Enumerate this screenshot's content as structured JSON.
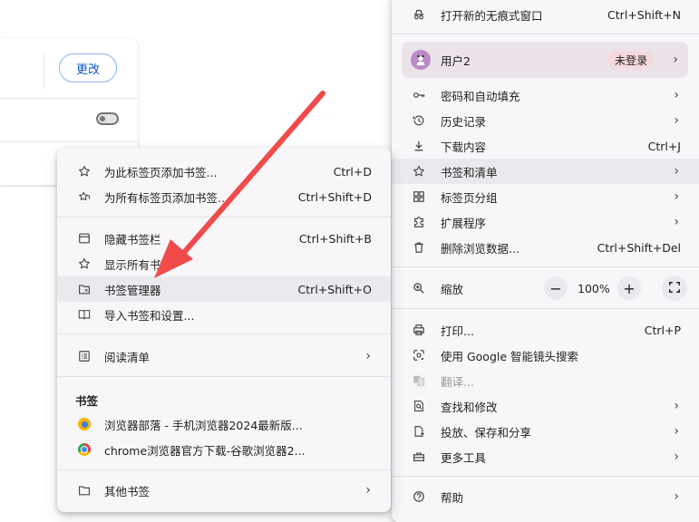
{
  "background": {
    "change_label": "更改"
  },
  "main_menu": {
    "incognito": {
      "label": "打开新的无痕式窗口",
      "shortcut": "Ctrl+Shift+N"
    },
    "profile": {
      "name": "用户2",
      "status": "未登录"
    },
    "passwords": {
      "label": "密码和自动填充"
    },
    "history": {
      "label": "历史记录"
    },
    "downloads": {
      "label": "下载内容",
      "shortcut": "Ctrl+J"
    },
    "bookmarks": {
      "label": "书签和清单"
    },
    "tab_groups": {
      "label": "标签页分组"
    },
    "extensions": {
      "label": "扩展程序"
    },
    "clear_data": {
      "label": "删除浏览数据...",
      "shortcut": "Ctrl+Shift+Del"
    },
    "zoom": {
      "label": "缩放",
      "minus": "−",
      "value": "100%",
      "plus": "+"
    },
    "print": {
      "label": "打印...",
      "shortcut": "Ctrl+P"
    },
    "lens": {
      "label": "使用 Google 智能镜头搜索"
    },
    "translate": {
      "label": "翻译..."
    },
    "find": {
      "label": "查找和修改"
    },
    "cast": {
      "label": "投放、保存和分享"
    },
    "more_tools": {
      "label": "更多工具"
    },
    "help": {
      "label": "帮助"
    }
  },
  "bookmark_menu": {
    "add_this": {
      "label": "为此标签页添加书签...",
      "shortcut": "Ctrl+D"
    },
    "add_all": {
      "label": "为所有标签页添加书签...",
      "shortcut": "Ctrl+Shift+D"
    },
    "hide_bar": {
      "label": "隐藏书签栏",
      "shortcut": "Ctrl+Shift+B"
    },
    "show_all": {
      "label": "显示所有书"
    },
    "manager": {
      "label": "书签管理器",
      "shortcut": "Ctrl+Shift+O"
    },
    "import": {
      "label": "导入书签和设置..."
    },
    "reading_list": {
      "label": "阅读清单"
    },
    "section_title": "书签",
    "bookmark_1": {
      "label": "浏览器部落 - 手机浏览器2024最新版..."
    },
    "bookmark_2": {
      "label": "chrome浏览器官方下载-谷歌浏览器2..."
    },
    "other": {
      "label": "其他书签"
    }
  },
  "icons": {
    "incognito": "incognito-icon",
    "key": "key-icon",
    "history": "history-icon",
    "download": "download-icon",
    "star": "star-icon",
    "grid": "tab-groups-icon",
    "puzzle": "extension-icon",
    "trash": "trash-icon",
    "zoom": "zoom-icon",
    "print": "print-icon",
    "lens": "lens-icon",
    "translate": "translate-icon",
    "find": "find-icon",
    "cast": "share-icon",
    "toolbox": "toolbox-icon",
    "help": "help-icon"
  },
  "colors": {
    "arrow": "#ef4b4b",
    "accent": "#0b57d0",
    "highlight": "#ece9ee",
    "profile_bg": "#ece2ea"
  }
}
